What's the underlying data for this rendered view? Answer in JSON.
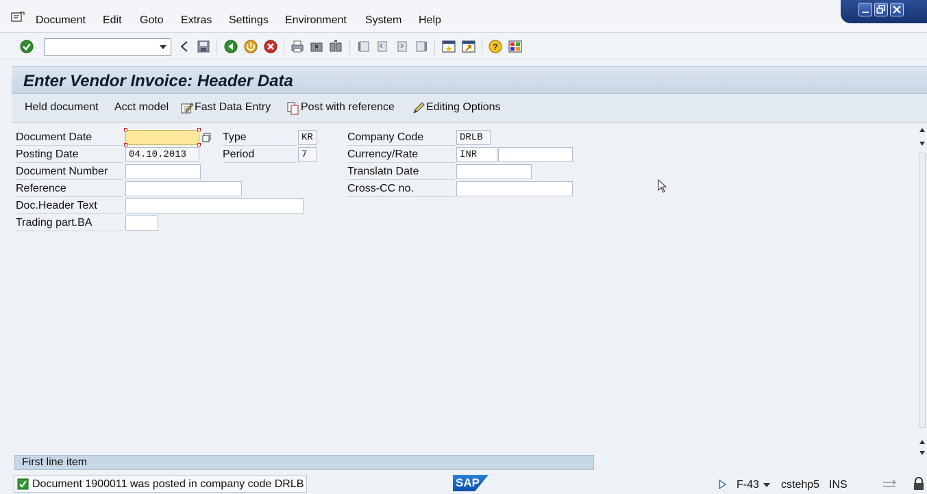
{
  "menu": {
    "items": [
      {
        "label": "Document"
      },
      {
        "label": "Edit"
      },
      {
        "label": "Goto"
      },
      {
        "label": "Extras"
      },
      {
        "label": "Settings"
      },
      {
        "label": "Environment"
      },
      {
        "label": "System"
      },
      {
        "label": "Help"
      }
    ]
  },
  "toolbar": {
    "command_value": "",
    "icons": [
      "enter-icon",
      "back-nav-icon",
      "save-icon",
      "back-icon",
      "exit-icon",
      "cancel-icon",
      "print-icon",
      "find-icon",
      "find-next-icon",
      "first-page-icon",
      "previous-page-icon",
      "next-page-icon",
      "last-page-icon",
      "create-session-icon",
      "shortcut-icon",
      "help-icon",
      "customize-layout-icon"
    ]
  },
  "title": "Enter Vendor Invoice: Header Data",
  "app_toolbar": {
    "held_document": "Held document",
    "acct_model": "Acct model",
    "fast_data_entry": "Fast Data Entry",
    "post_with_reference": "Post with reference",
    "editing_options": "Editing Options"
  },
  "form": {
    "document_date": {
      "label": "Document Date",
      "value": ""
    },
    "posting_date": {
      "label": "Posting Date",
      "value": "04.10.2013"
    },
    "document_number": {
      "label": "Document Number",
      "value": ""
    },
    "reference": {
      "label": "Reference",
      "value": ""
    },
    "doc_header_text": {
      "label": "Doc.Header Text",
      "value": ""
    },
    "trading_part_ba": {
      "label": "Trading part.BA",
      "value": ""
    },
    "type": {
      "label": "Type",
      "value": "KR"
    },
    "period": {
      "label": "Period",
      "value": "7"
    },
    "company_code": {
      "label": "Company Code",
      "value": "DRLB"
    },
    "currency_rate": {
      "label": "Currency/Rate",
      "value": "INR",
      "rate": ""
    },
    "translatn_date": {
      "label": "Translatn Date",
      "value": ""
    },
    "cross_cc_no": {
      "label": "Cross-CC no.",
      "value": ""
    }
  },
  "first_line_item": "First line item",
  "status": {
    "message": "Document 1900011 was posted in company code DRLB",
    "transaction": "F-43",
    "server": "cstehp5",
    "mode": "INS"
  },
  "colors": {
    "focus_field": "#ffe99a",
    "title_bar": "#c8d6e4",
    "window_controls": "#173270"
  }
}
